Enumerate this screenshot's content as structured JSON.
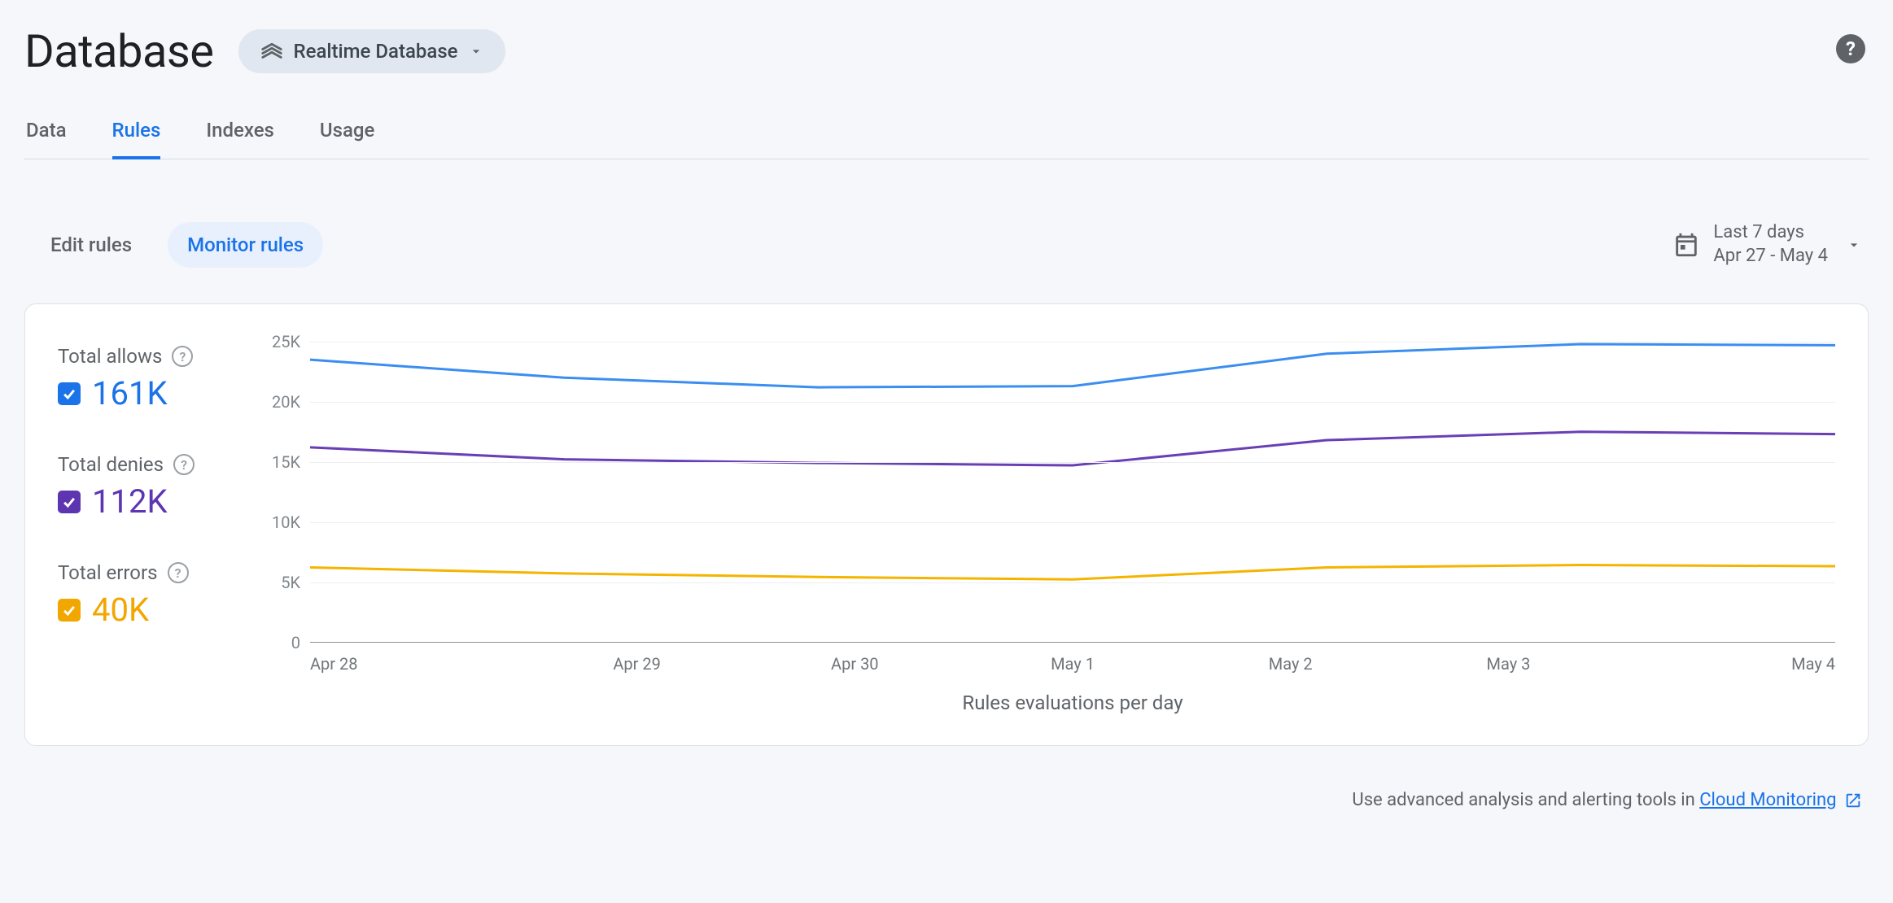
{
  "header": {
    "title": "Database",
    "db_selector_label": "Realtime Database"
  },
  "tabs": [
    {
      "label": "Data",
      "active": false
    },
    {
      "label": "Rules",
      "active": true
    },
    {
      "label": "Indexes",
      "active": false
    },
    {
      "label": "Usage",
      "active": false
    }
  ],
  "subtabs": [
    {
      "label": "Edit rules",
      "active": false
    },
    {
      "label": "Monitor rules",
      "active": true
    }
  ],
  "date_range": {
    "label": "Last 7 days",
    "range": "Apr 27 - May 4"
  },
  "legend": {
    "allows": {
      "label": "Total allows",
      "value": "161K",
      "color": "#1a73e8",
      "bg": "#1a73e8"
    },
    "denies": {
      "label": "Total denies",
      "value": "112K",
      "color": "#5e35b1",
      "bg": "#5e35b1"
    },
    "errors": {
      "label": "Total errors",
      "value": "40K",
      "color": "#f2a600",
      "bg": "#f2a600"
    }
  },
  "chart_data": {
    "type": "line",
    "title": "",
    "xlabel": "Rules evaluations per day",
    "ylabel": "",
    "ylim": [
      0,
      25000
    ],
    "y_ticks": [
      "0",
      "5K",
      "10K",
      "15K",
      "20K",
      "25K"
    ],
    "categories": [
      "Apr 28",
      "Apr 29",
      "Apr 30",
      "May 1",
      "May 2",
      "May 3",
      "May 4"
    ],
    "series": [
      {
        "name": "Total allows",
        "color": "#3b8ef0",
        "values": [
          23500,
          22000,
          21200,
          21300,
          24000,
          24800,
          24700
        ]
      },
      {
        "name": "Total denies",
        "color": "#6a3fb5",
        "values": [
          16200,
          15200,
          14900,
          14700,
          16800,
          17500,
          17300
        ]
      },
      {
        "name": "Total errors",
        "color": "#f4b400",
        "values": [
          6200,
          5700,
          5400,
          5200,
          6200,
          6400,
          6300
        ]
      }
    ]
  },
  "footer": {
    "text": "Use advanced analysis and alerting tools in ",
    "link_text": "Cloud Monitoring"
  }
}
